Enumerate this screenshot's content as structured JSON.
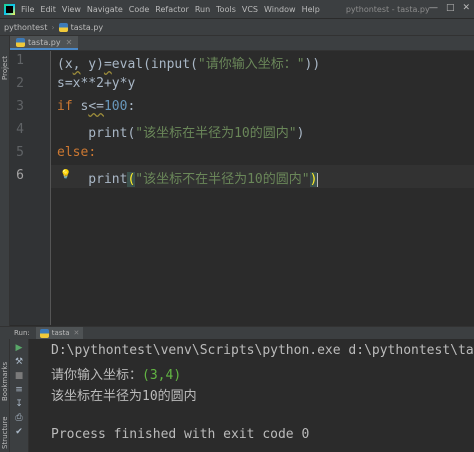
{
  "menubar": {
    "items": [
      "File",
      "Edit",
      "View",
      "Navigate",
      "Code",
      "Refactor",
      "Run",
      "Tools",
      "VCS",
      "Window",
      "Help"
    ],
    "window_title": "pythontest - tasta.py"
  },
  "breadcrumb": {
    "project": "pythontest",
    "file": "tasta.py"
  },
  "side_labels": {
    "project": "Project",
    "bookmarks": "Bookmarks",
    "structure": "Structure"
  },
  "editor": {
    "tab_label": "tasta.py",
    "line_numbers": [
      "1",
      "2",
      "3",
      "4",
      "5",
      "6"
    ],
    "lines": {
      "l1_a": "(x",
      "l1_b": ",",
      "l1_c": " y)",
      "l1_d": "=",
      "l1_e": "eval(input(",
      "l1_str": "\"请你输入坐标：\"",
      "l1_f": "))",
      "l2": "s=x**2+y*y",
      "l3_kw": "if",
      "l3_a": " s",
      "l3_b": "<=",
      "l3_num": "100",
      "l3_c": ":",
      "l4_fn": "    print(",
      "l4_str": "\"该坐标在半径为10的圆内\"",
      "l4_c": ")",
      "l5_kw": "else",
      "l5_c": ":",
      "l6_fn": "    print",
      "l6_open": "(",
      "l6_str": "\"该坐标不在半径为10的圆内\"",
      "l6_close": ")"
    }
  },
  "run_panel": {
    "label": "Run:",
    "tab": "tasta",
    "console": {
      "cmd": "D:\\pythontest\\venv\\Scripts\\python.exe d:\\pythontest\\tasta",
      "prompt": "请你输入坐标：",
      "input": "(3,4)",
      "result": "该坐标在半径为10的圆内",
      "exit": "Process finished with exit code 0"
    }
  },
  "colors": {
    "background": "#2b2b2b",
    "keyword": "#cc7832",
    "number": "#6897bb",
    "string": "#6a8759",
    "console_input": "#62b543"
  }
}
